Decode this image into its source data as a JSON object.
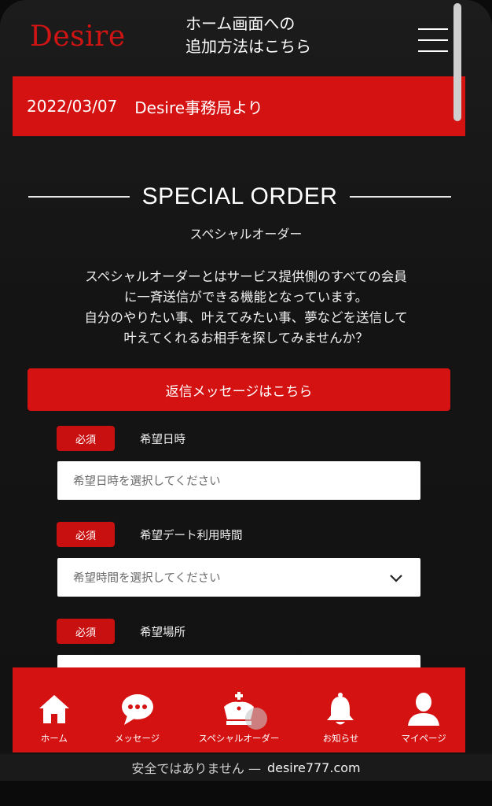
{
  "header": {
    "logo": "Desire",
    "add_home_line1": "ホーム画面への",
    "add_home_line2": "追加方法はこちら"
  },
  "notice": {
    "date": "2022/03/07",
    "text": "Desire事務局より"
  },
  "section": {
    "title": "SPECIAL ORDER",
    "subtitle": "スペシャルオーダー",
    "description": [
      "スペシャルオーダーとはサービス提供側のすべての会員",
      "に一斉送信ができる機能となっています。",
      "自分のやりたい事、叶えてみたい事、夢などを送信して",
      "叶えてくれるお相手を探してみませんか？"
    ]
  },
  "reply_button": "返信メッセージはこちら",
  "form": {
    "fields": [
      {
        "required": "必須",
        "label": "希望日時",
        "placeholder": "希望日時を選択してください"
      },
      {
        "required": "必須",
        "label": "希望デート利用時間",
        "placeholder": "希望時間を選択してください"
      },
      {
        "required": "必須",
        "label": "希望場所",
        "placeholder": ""
      }
    ]
  },
  "bottom_nav": [
    {
      "label": "ホーム",
      "icon": "home-icon"
    },
    {
      "label": "メッセージ",
      "icon": "chat-bubble-icon"
    },
    {
      "label": "スペシャルオーダー",
      "icon": "crown-icon"
    },
    {
      "label": "お知らせ",
      "icon": "bell-icon"
    },
    {
      "label": "マイページ",
      "icon": "user-icon"
    }
  ],
  "browser": {
    "security": "安全ではありません —",
    "domain": "desire777.com"
  },
  "colors": {
    "accent": "#d51212",
    "logo": "#d01414",
    "background": "#141414"
  }
}
